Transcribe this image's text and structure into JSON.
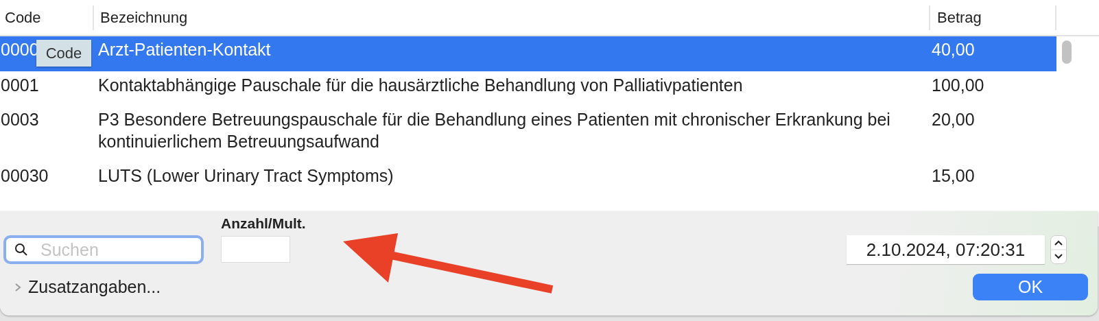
{
  "table": {
    "columns": [
      "Code",
      "Bezeichnung",
      "Betrag"
    ],
    "rows": [
      {
        "code": "0000",
        "description": "Arzt-Patienten-Kontakt",
        "amount": "40,00",
        "selected": true
      },
      {
        "code": "0001",
        "description": "Kontaktabhängige Pauschale für die hausärztliche Behandlung von Palliativpatienten",
        "amount": "100,00",
        "selected": false
      },
      {
        "code": "0003",
        "description": "P3 Besondere Betreuungspauschale für die Behandlung eines Patienten mit chronischer Erkrankung bei kontinuierlichem Betreuungsaufwand",
        "amount": "20,00",
        "selected": false
      },
      {
        "code": "00030",
        "description": "LUTS (Lower Urinary Tract Symptoms)",
        "amount": "15,00",
        "selected": false
      }
    ],
    "tooltip": "Code"
  },
  "panel": {
    "search": {
      "placeholder": "Suchen",
      "focused": true
    },
    "quantity_label": "Anzahl/Mult.",
    "date_time": "2.10.2024, 07:20:31",
    "disclosure": {
      "label": "Zusatzangaben...",
      "expanded": false
    },
    "ok_button": "OK"
  }
}
